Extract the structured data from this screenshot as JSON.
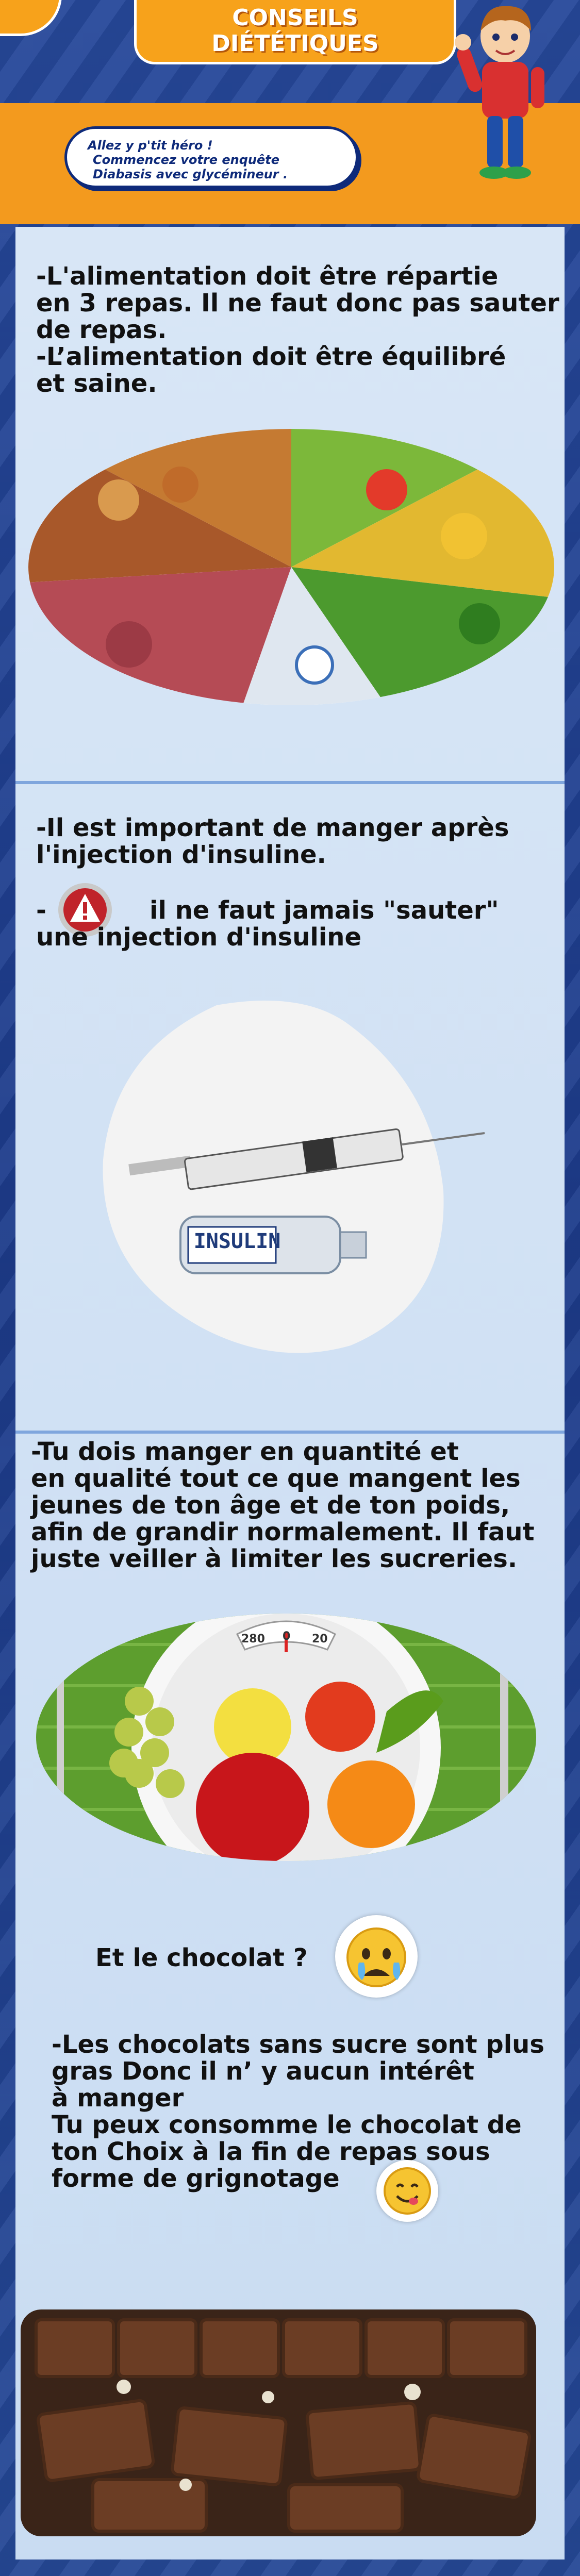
{
  "header": {
    "title_lines": [
      "CONSEILS",
      "DIÉTÉTIQUES"
    ],
    "bubble_lines": [
      "Allez y p'tit héro !",
      "Commencez votre enquête",
      "Diabasis avec glycémineur ."
    ]
  },
  "sections": {
    "repas": {
      "lines": [
        "-L'alimentation doit être répartie",
        " en 3 repas. Il ne faut donc pas sauter",
        " de repas.",
        "-L’alimentation doit être équilibré",
        " et saine."
      ]
    },
    "insuline": {
      "line1": "-Il est important de manger après",
      "line2": " l'injection d'insuline.",
      "warn_prefix": "-",
      "warn_line1": "il ne faut jamais \"sauter\"",
      "warn_line2": " une injection d'insuline",
      "label_on_vial": "INSULIN"
    },
    "quantite": {
      "lines": [
        "-Tu dois manger en quantité et",
        " en qualité tout ce que mangent les",
        " jeunes de ton âge et de ton poids,",
        " afin de grandir normalement. Il faut",
        " juste veiller à limiter les sucreries."
      ],
      "scale_numbers": [
        "280",
        "0",
        "20"
      ]
    },
    "chocolat": {
      "question": "Et le chocolat ?",
      "lines": [
        "-Les chocolats sans sucre sont plus",
        " gras Donc il n’ y aucun intérêt",
        " à manger",
        " Tu peux consomme le chocolat de",
        " ton Choix à la fin de repas sous",
        " forme de grignotage"
      ]
    }
  },
  "icons": {
    "warning": "warning-icon",
    "sad_face": "crying-face-icon",
    "happy_face": "yum-face-icon"
  },
  "colors": {
    "background": "#1f3f8c",
    "header_band": "#f39a1e",
    "panel": "#d8e6f6",
    "text": "#111111"
  }
}
